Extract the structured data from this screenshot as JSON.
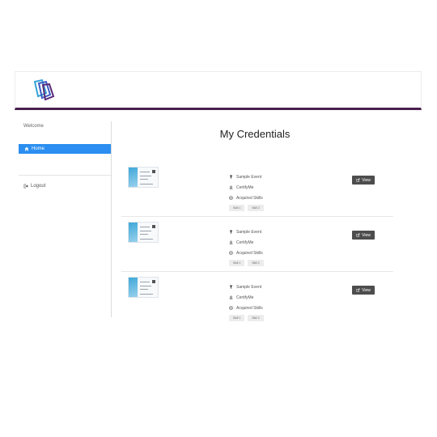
{
  "header": {
    "logo_icon": "book-stack-logo",
    "accent_color": "#4a1f4f"
  },
  "sidebar": {
    "welcome": "Welcome",
    "items": [
      {
        "label": "Home",
        "icon": "home-icon",
        "active": true,
        "color": "#2b8ef0"
      },
      {
        "label": "Logout",
        "icon": "logout-icon",
        "active": false
      }
    ]
  },
  "main": {
    "title": "My Credentials",
    "credentials": [
      {
        "event": "Sample Event",
        "issuer": "CertifyMe",
        "skills_heading": "Acquired Skills",
        "skills": [
          "Skill 1",
          "Skill 2"
        ],
        "view_label": "View"
      },
      {
        "event": "Sample Event",
        "issuer": "CertifyMe",
        "skills_heading": "Acquired Skills",
        "skills": [
          "Skill 1",
          "Skill 2"
        ],
        "view_label": "View"
      },
      {
        "event": "Sample Event",
        "issuer": "CertifyMe",
        "skills_heading": "Acquired Skills",
        "skills": [
          "Skill 1",
          "Skill 2"
        ],
        "view_label": "View"
      }
    ]
  }
}
